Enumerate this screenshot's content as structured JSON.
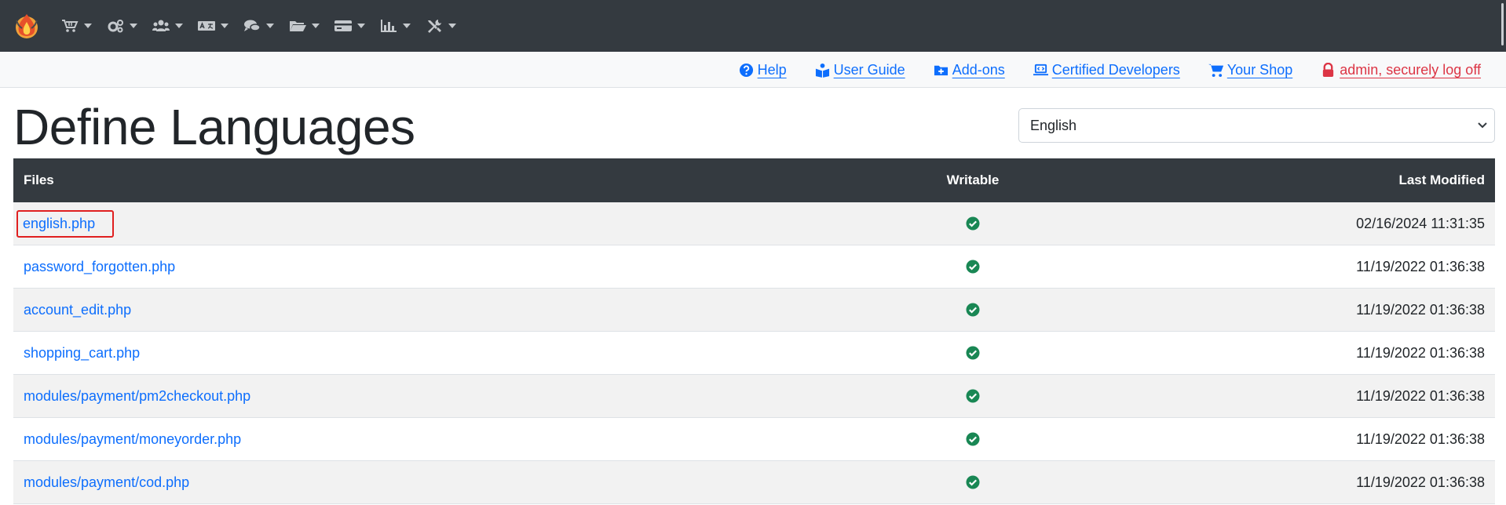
{
  "navbar": {
    "menus": [
      {
        "icon": "cart-icon"
      },
      {
        "icon": "gears-icon"
      },
      {
        "icon": "users-icon"
      },
      {
        "icon": "language-icon"
      },
      {
        "icon": "comments-icon"
      },
      {
        "icon": "folder-icon"
      },
      {
        "icon": "credit-card-icon"
      },
      {
        "icon": "chart-icon"
      },
      {
        "icon": "tools-icon"
      }
    ]
  },
  "linkbar": {
    "help": "Help",
    "user_guide": "User Guide",
    "addons": "Add-ons",
    "certified_developers": "Certified Developers",
    "your_shop": "Your Shop",
    "logoff": "admin, securely log off"
  },
  "page": {
    "title": "Define Languages",
    "language_select": "English"
  },
  "table": {
    "headers": {
      "files": "Files",
      "writable": "Writable",
      "last_modified": "Last Modified"
    },
    "rows": [
      {
        "file": "english.php",
        "modified": "02/16/2024 11:31:35"
      },
      {
        "file": "password_forgotten.php",
        "modified": "11/19/2022 01:36:38"
      },
      {
        "file": "account_edit.php",
        "modified": "11/19/2022 01:36:38"
      },
      {
        "file": "shopping_cart.php",
        "modified": "11/19/2022 01:36:38"
      },
      {
        "file": "modules/payment/pm2checkout.php",
        "modified": "11/19/2022 01:36:38"
      },
      {
        "file": "modules/payment/moneyorder.php",
        "modified": "11/19/2022 01:36:38"
      },
      {
        "file": "modules/payment/cod.php",
        "modified": "11/19/2022 01:36:38"
      }
    ]
  },
  "colors": {
    "navbar": "#343a40",
    "link": "#0d6efd",
    "danger": "#dc3545",
    "success": "#198754",
    "highlight": "#e02020"
  }
}
